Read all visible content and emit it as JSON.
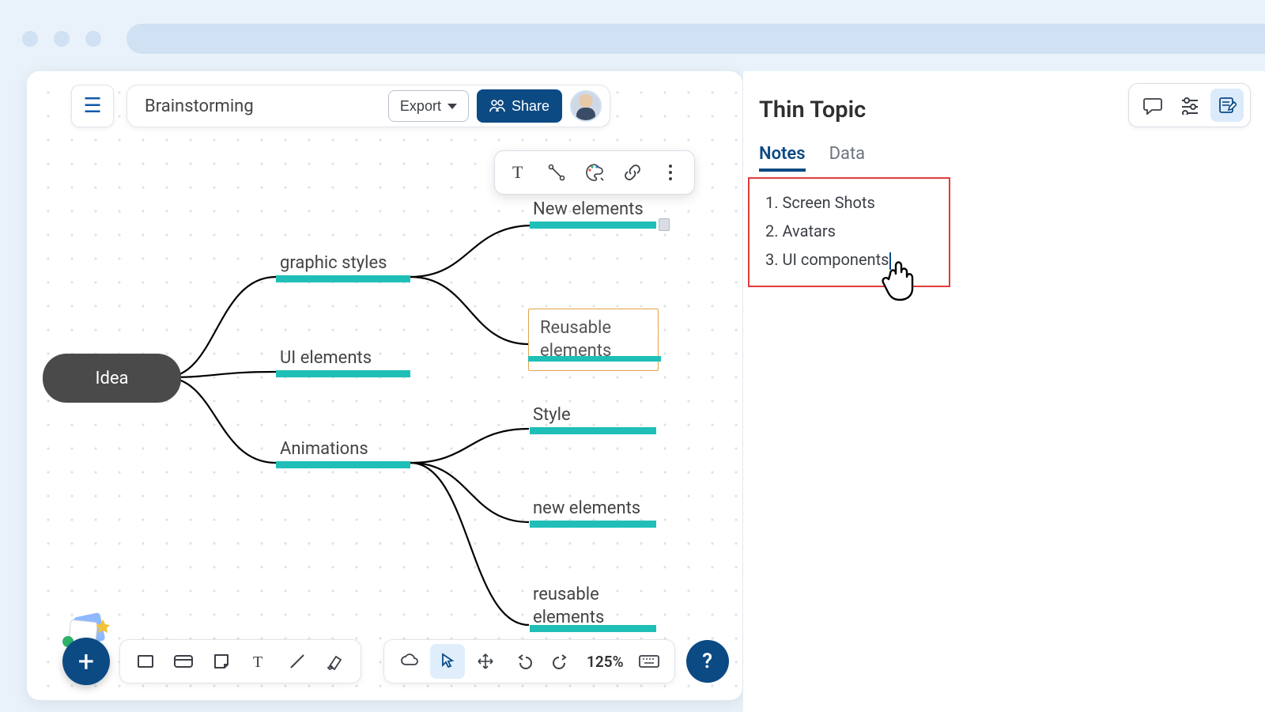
{
  "header": {
    "doc_title": "Brainstorming",
    "export_label": "Export",
    "share_label": "Share"
  },
  "context_toolbar": {
    "icons": [
      "text-icon",
      "connector-icon",
      "palette-icon",
      "link-icon",
      "more-icon"
    ]
  },
  "mindmap": {
    "root": "Idea",
    "nodes": {
      "graphic_styles": "graphic styles",
      "ui_elements": "UI elements",
      "animations": "Animations",
      "new_elements_1": "New elements",
      "reusable_elements_1": "Reusable elements",
      "style": "Style",
      "new_elements_2": "new elements",
      "reusable_elements_2": "reusable elements"
    }
  },
  "bottom_toolbar": {
    "zoom": "125%"
  },
  "side_panel": {
    "title": "Thin Topic",
    "tabs": {
      "notes": "Notes",
      "data": "Data"
    },
    "notes": [
      "1. Screen Shots",
      "2. Avatars",
      "3. UI components"
    ]
  },
  "colors": {
    "accent_teal": "#1fbfb8",
    "brand_navy": "#0c4a83",
    "highlight_red": "#e13b3b"
  }
}
